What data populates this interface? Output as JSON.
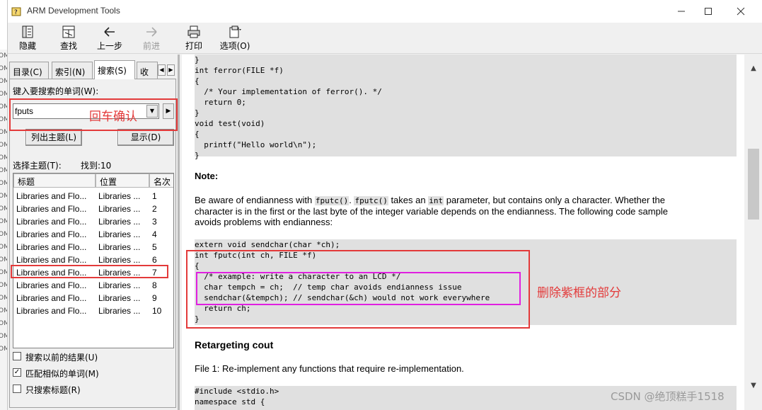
{
  "window": {
    "title": "ARM Development Tools"
  },
  "background_strip": [
    "OM",
    "OM",
    "OM",
    "OM",
    "OM",
    "OM",
    "OM",
    "OM",
    "OM",
    "OM",
    "OM",
    "OM",
    "OM",
    "OM",
    "OM",
    "OM",
    "OM",
    "OM",
    "OM",
    "OM",
    "OM",
    "OM",
    "OM",
    "OM"
  ],
  "toolbar": {
    "hide": "隐藏",
    "find": "查找",
    "back": "上一步",
    "forward": "前进",
    "print": "打印",
    "options": "选项(O)"
  },
  "tabs": [
    "目录(C)",
    "索引(N)",
    "搜索(S)",
    "收"
  ],
  "search": {
    "prompt": "键入要搜索的单词(W):",
    "value": "fputs",
    "list_topics": "列出主题(L)",
    "display": "显示(D)",
    "select_topic": "选择主题(T):",
    "found": "找到:10"
  },
  "results": {
    "columns": [
      "标题",
      "位置",
      "名次"
    ],
    "rows": [
      [
        "Libraries and Flo...",
        "Libraries ...",
        "1"
      ],
      [
        "Libraries and Flo...",
        "Libraries ...",
        "2"
      ],
      [
        "Libraries and Flo...",
        "Libraries ...",
        "3"
      ],
      [
        "Libraries and Flo...",
        "Libraries ...",
        "4"
      ],
      [
        "Libraries and Flo...",
        "Libraries ...",
        "5"
      ],
      [
        "Libraries and Flo...",
        "Libraries ...",
        "6"
      ],
      [
        "Libraries and Flo...",
        "Libraries ...",
        "7"
      ],
      [
        "Libraries and Flo...",
        "Libraries ...",
        "8"
      ],
      [
        "Libraries and Flo...",
        "Libraries ...",
        "9"
      ],
      [
        "Libraries and Flo...",
        "Libraries ...",
        "10"
      ]
    ]
  },
  "checkboxes": {
    "search_previous": "搜索以前的结果(U)",
    "match_similar": "匹配相似的单词(M)",
    "titles_only": "只搜索标题(R)"
  },
  "annotations": {
    "enter_confirm": "回车确认",
    "delete_purple": "删除紫框的部分"
  },
  "content": {
    "code1": [
      "}",
      "int ferror(FILE *f)",
      "{",
      "  /* Your implementation of ferror(). */",
      "  return 0;",
      "}",
      "void test(void)",
      "{",
      "  printf(\"Hello world\\n\");",
      "}"
    ],
    "note_heading": "Note:",
    "para1_a": "Be aware of endianness with",
    "para1_c1": "fputc()",
    "para1_sep": ".",
    "para1_c2": "fputc()",
    "para1_b": "takes an",
    "para1_c3": "int",
    "para1_c": "parameter, but contains only a character. Whether the",
    "para1_line2": "character is in the first or the last byte of the integer variable depends on the endianness. The following code sample",
    "para1_line3": "avoids problems with endianness:",
    "code2": [
      "extern void sendchar(char *ch);",
      "int fputc(int ch, FILE *f)",
      "{",
      "  /* example: write a character to an LCD */",
      "  char tempch = ch;  // temp char avoids endianness issue",
      "  sendchar(&tempch); // sendchar(&ch) would not work everywhere",
      "  return ch;",
      "}"
    ],
    "retarget_heading": "Retargeting cout",
    "file1": "File 1: Re-implement any functions that require re-implementation.",
    "code3": [
      "#include <stdio.h>",
      "namespace std {"
    ]
  },
  "watermark": "CSDN @绝顶糕手1518"
}
